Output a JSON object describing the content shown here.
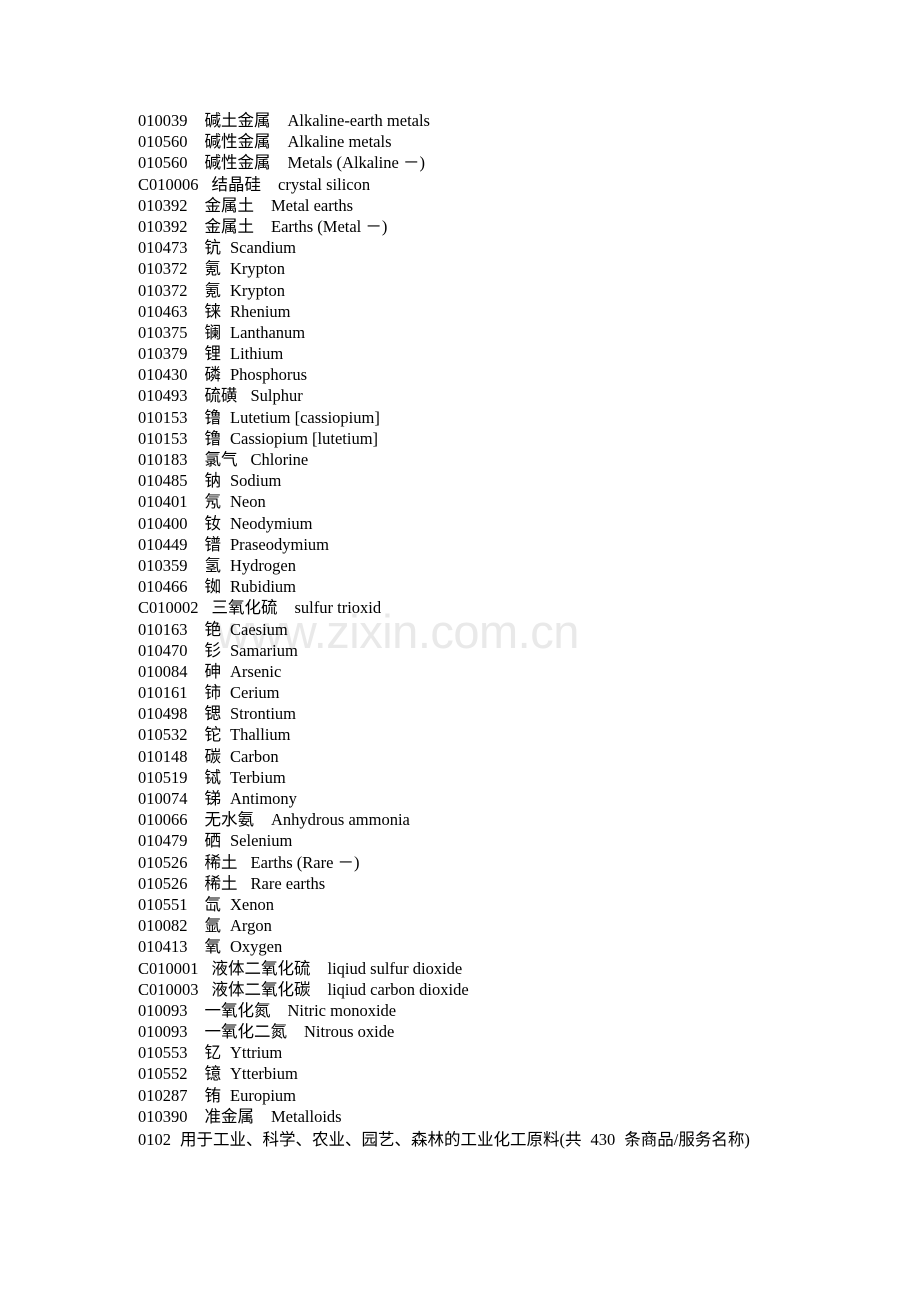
{
  "document": {
    "watermark": "www.zixin.com.cn",
    "entries": [
      {
        "code": "010039",
        "cn": "碱土金属",
        "en": "Alkaline-earth metals"
      },
      {
        "code": "010560",
        "cn": "碱性金属",
        "en": "Alkaline metals"
      },
      {
        "code": "010560",
        "cn": "碱性金属",
        "en": "Metals (Alkaline －)"
      },
      {
        "code": "C010006",
        "cn": "结晶硅",
        "en": "crystal silicon"
      },
      {
        "code": "010392",
        "cn": "金属土",
        "en": "Metal earths"
      },
      {
        "code": "010392",
        "cn": "金属土",
        "en": "Earths (Metal －)"
      },
      {
        "code": "010473",
        "cn": "钪",
        "en": "Scandium"
      },
      {
        "code": "010372",
        "cn": "氪",
        "en": "Krypton"
      },
      {
        "code": "010372",
        "cn": "氪",
        "en": "Krypton"
      },
      {
        "code": "010463",
        "cn": "铼",
        "en": "Rhenium"
      },
      {
        "code": "010375",
        "cn": "镧",
        "en": "Lanthanum"
      },
      {
        "code": "010379",
        "cn": "锂",
        "en": "Lithium"
      },
      {
        "code": "010430",
        "cn": "磷",
        "en": "Phosphorus"
      },
      {
        "code": "010493",
        "cn": "硫磺",
        "en": "Sulphur"
      },
      {
        "code": "010153",
        "cn": "镥",
        "en": "Lutetium [cassiopium]"
      },
      {
        "code": "010153",
        "cn": "镥",
        "en": "Cassiopium [lutetium]"
      },
      {
        "code": "010183",
        "cn": "氯气",
        "en": "Chlorine"
      },
      {
        "code": "010485",
        "cn": "钠",
        "en": "Sodium"
      },
      {
        "code": "010401",
        "cn": "氖",
        "en": "Neon"
      },
      {
        "code": "010400",
        "cn": "钕",
        "en": "Neodymium"
      },
      {
        "code": "010449",
        "cn": "镨",
        "en": "Praseodymium"
      },
      {
        "code": "010359",
        "cn": "氢",
        "en": "Hydrogen"
      },
      {
        "code": "010466",
        "cn": "铷",
        "en": "Rubidium"
      },
      {
        "code": "C010002",
        "cn": "三氧化硫",
        "en": "sulfur trioxid"
      },
      {
        "code": "010163",
        "cn": "铯",
        "en": "Caesium"
      },
      {
        "code": "010470",
        "cn": "钐",
        "en": "Samarium"
      },
      {
        "code": "010084",
        "cn": "砷",
        "en": "Arsenic"
      },
      {
        "code": "010161",
        "cn": "铈",
        "en": "Cerium"
      },
      {
        "code": "010498",
        "cn": "锶",
        "en": "Strontium"
      },
      {
        "code": "010532",
        "cn": "铊",
        "en": "Thallium"
      },
      {
        "code": "010148",
        "cn": "碳",
        "en": "Carbon"
      },
      {
        "code": "010519",
        "cn": "铽",
        "en": "Terbium"
      },
      {
        "code": "010074",
        "cn": "锑",
        "en": "Antimony"
      },
      {
        "code": "010066",
        "cn": "无水氨",
        "en": "Anhydrous ammonia"
      },
      {
        "code": "010479",
        "cn": "硒",
        "en": "Selenium"
      },
      {
        "code": "010526",
        "cn": "稀土",
        "en": "Earths (Rare －)"
      },
      {
        "code": "010526",
        "cn": "稀土",
        "en": "Rare earths"
      },
      {
        "code": "010551",
        "cn": "氙",
        "en": "Xenon"
      },
      {
        "code": "010082",
        "cn": "氩",
        "en": "Argon"
      },
      {
        "code": "010413",
        "cn": "氧",
        "en": "Oxygen"
      },
      {
        "code": "C010001",
        "cn": "液体二氧化硫",
        "en": "liqiud sulfur dioxide"
      },
      {
        "code": "C010003",
        "cn": "液体二氧化碳",
        "en": "liqiud carbon dioxide"
      },
      {
        "code": "010093",
        "cn": "一氧化氮",
        "en": "Nitric monoxide"
      },
      {
        "code": "010093",
        "cn": "一氧化二氮",
        "en": "Nitrous oxide"
      },
      {
        "code": "010553",
        "cn": "钇",
        "en": "Yttrium"
      },
      {
        "code": "010552",
        "cn": "镱",
        "en": "Ytterbium"
      },
      {
        "code": "010287",
        "cn": "铕",
        "en": "Europium"
      },
      {
        "code": "010390",
        "cn": "准金属",
        "en": "Metalloids"
      }
    ],
    "footer": {
      "code": "0102",
      "text_before": "用于工业、科学、农业、园艺、森林的工业化工原料(共",
      "count": "430",
      "text_after": "条商品/服务名称)"
    }
  }
}
